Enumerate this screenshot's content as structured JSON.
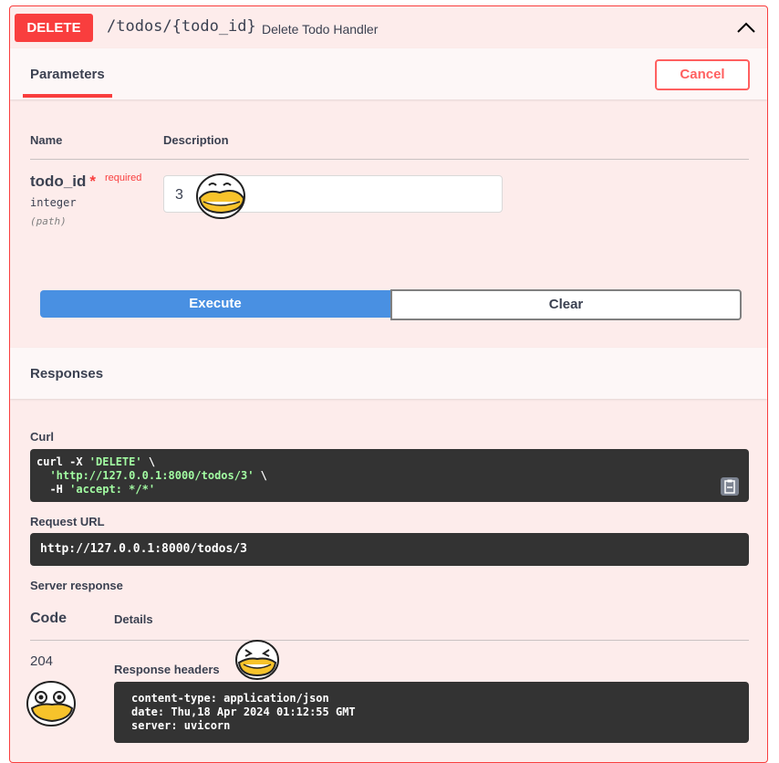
{
  "summary": {
    "method": "DELETE",
    "path": "/todos/{todo_id}",
    "description": "Delete Todo Handler"
  },
  "parameters": {
    "tab_label": "Parameters",
    "cancel_label": "Cancel",
    "col_name": "Name",
    "col_description": "Description",
    "param": {
      "name": "todo_id",
      "required_star": "*",
      "required_label": "required",
      "type": "integer",
      "in": "(path)",
      "value": "3"
    },
    "execute_label": "Execute",
    "clear_label": "Clear"
  },
  "responses": {
    "title": "Responses",
    "curl_title": "Curl",
    "curl": {
      "l1_cmd": "curl -X ",
      "l1_method": "'DELETE'",
      "l1_end": " \\",
      "l2_indent": "  ",
      "l2_url": "'http://127.0.0.1:8000/todos/3'",
      "l2_end": " \\",
      "l3_flag": "  -H ",
      "l3_header": "'accept: */*'"
    },
    "request_url_title": "Request URL",
    "request_url": "http://127.0.0.1:8000/todos/3",
    "server_response_title": "Server response",
    "code_header": "Code",
    "details_header": "Details",
    "code": "204",
    "response_headers_title": "Response headers",
    "headers": [
      "content-type: application/json",
      "date: Thu,18 Apr 2024 01:12:55 GMT",
      "server: uvicorn"
    ]
  },
  "colors": {
    "delete": "#f93e3e",
    "execute": "#4990e2",
    "code_bg": "#333333",
    "string": "#a2fca2"
  },
  "icons": [
    "chevron-up-icon",
    "copy-to-clipboard-icon",
    "duck-sticker"
  ]
}
